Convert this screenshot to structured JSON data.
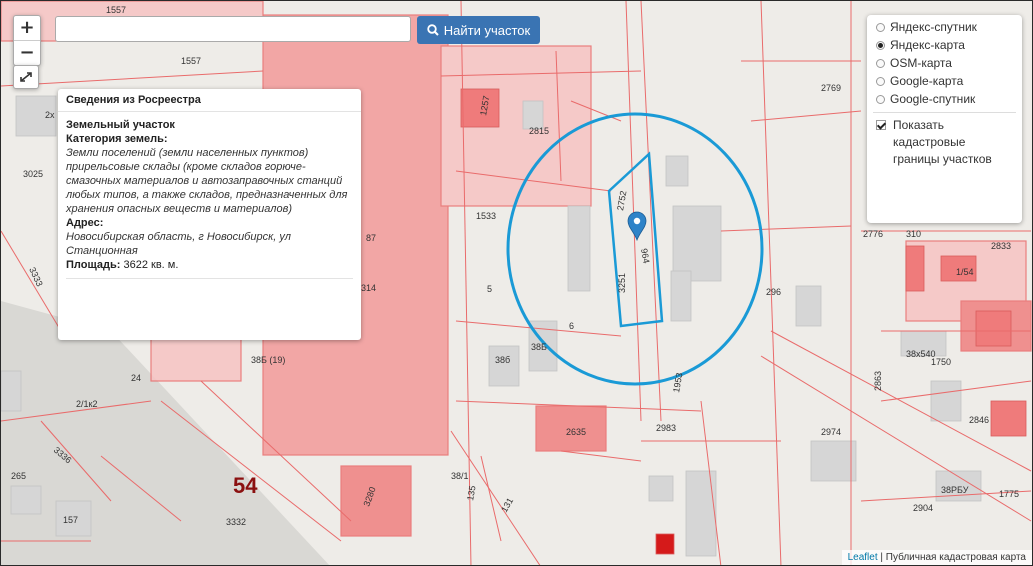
{
  "toolbar": {
    "zoom_in": "+",
    "zoom_out": "−",
    "search_placeholder": "",
    "search_value": "",
    "search_button": "Найти участок"
  },
  "info_panel": {
    "title": "Сведения из Росреестра",
    "object_type": "Земельный участок",
    "category_label": "Категория земель:",
    "category_value": "Земли поселений (земли населенных пунктов) прирельсовые склады (кроме складов горюче-смазочных материалов и автозаправочных станций любых типов, а также складов, предназначенных для хранения опасных веществ и материалов)",
    "address_label": "Адрес:",
    "address_value": "Новосибирская область, г Новосибирск, ул Станционная",
    "area_label": "Площадь:",
    "area_value": " 3622 кв. м."
  },
  "layers": {
    "base": [
      {
        "label": "Яндекс-спутник",
        "selected": false
      },
      {
        "label": "Яндекс-карта",
        "selected": true
      },
      {
        "label": "OSM-карта",
        "selected": false
      },
      {
        "label": "Google-карта",
        "selected": false
      },
      {
        "label": "Google-спутник",
        "selected": false
      }
    ],
    "overlay_label": "Показать кадастровые границы участков",
    "overlay_checked": true
  },
  "map_labels": {
    "l1557a": "1557",
    "l1557b": "1557",
    "l3025": "3025",
    "l2x": "2х",
    "l2769": "2769",
    "l2815": "2815",
    "l1257": "1257",
    "l1533": "1533",
    "l5": "5",
    "l6": "6",
    "l2752": "2752",
    "l3251": "3251",
    "l964": "964",
    "l296": "296",
    "l2776": "2776",
    "l310": "310",
    "l2833": "2833",
    "l1754": "1/54",
    "l3333": "3333",
    "l314": "314",
    "l87": "87",
    "l38b19": "38Б (19)",
    "l386": "38б",
    "l38b": "38Б",
    "l2x2": "2/1к2",
    "l3336": "3336",
    "l2635": "2635",
    "l2983": "2983",
    "l2863": "2863",
    "l2974": "2974",
    "l38x540": "38х540",
    "l1750": "1750",
    "l2846": "2846",
    "l54": "54",
    "l3332": "3332",
    "l157": "157",
    "l3280": "3280",
    "l381": "38/1",
    "l135": "135",
    "l131": "131",
    "l2904": "2904",
    "l38rbu": "38РБУ",
    "l1775": "1775",
    "l265": "265",
    "l1953": "1953",
    "l24": "24"
  },
  "attribution": {
    "leaflet": "Leaflet",
    "separator": " | ",
    "source": "Публичная кадастровая карта"
  },
  "colors": {
    "map_background": "#eeece8",
    "building": "#d6d6d6",
    "cadastral_fill": "#f4a3a3",
    "cadastral_line": "#e96b6b",
    "highlight_block": "#f08080",
    "ellipse": "#1a9ad6",
    "marker": "#2e83c8",
    "button": "#3a74b3"
  }
}
